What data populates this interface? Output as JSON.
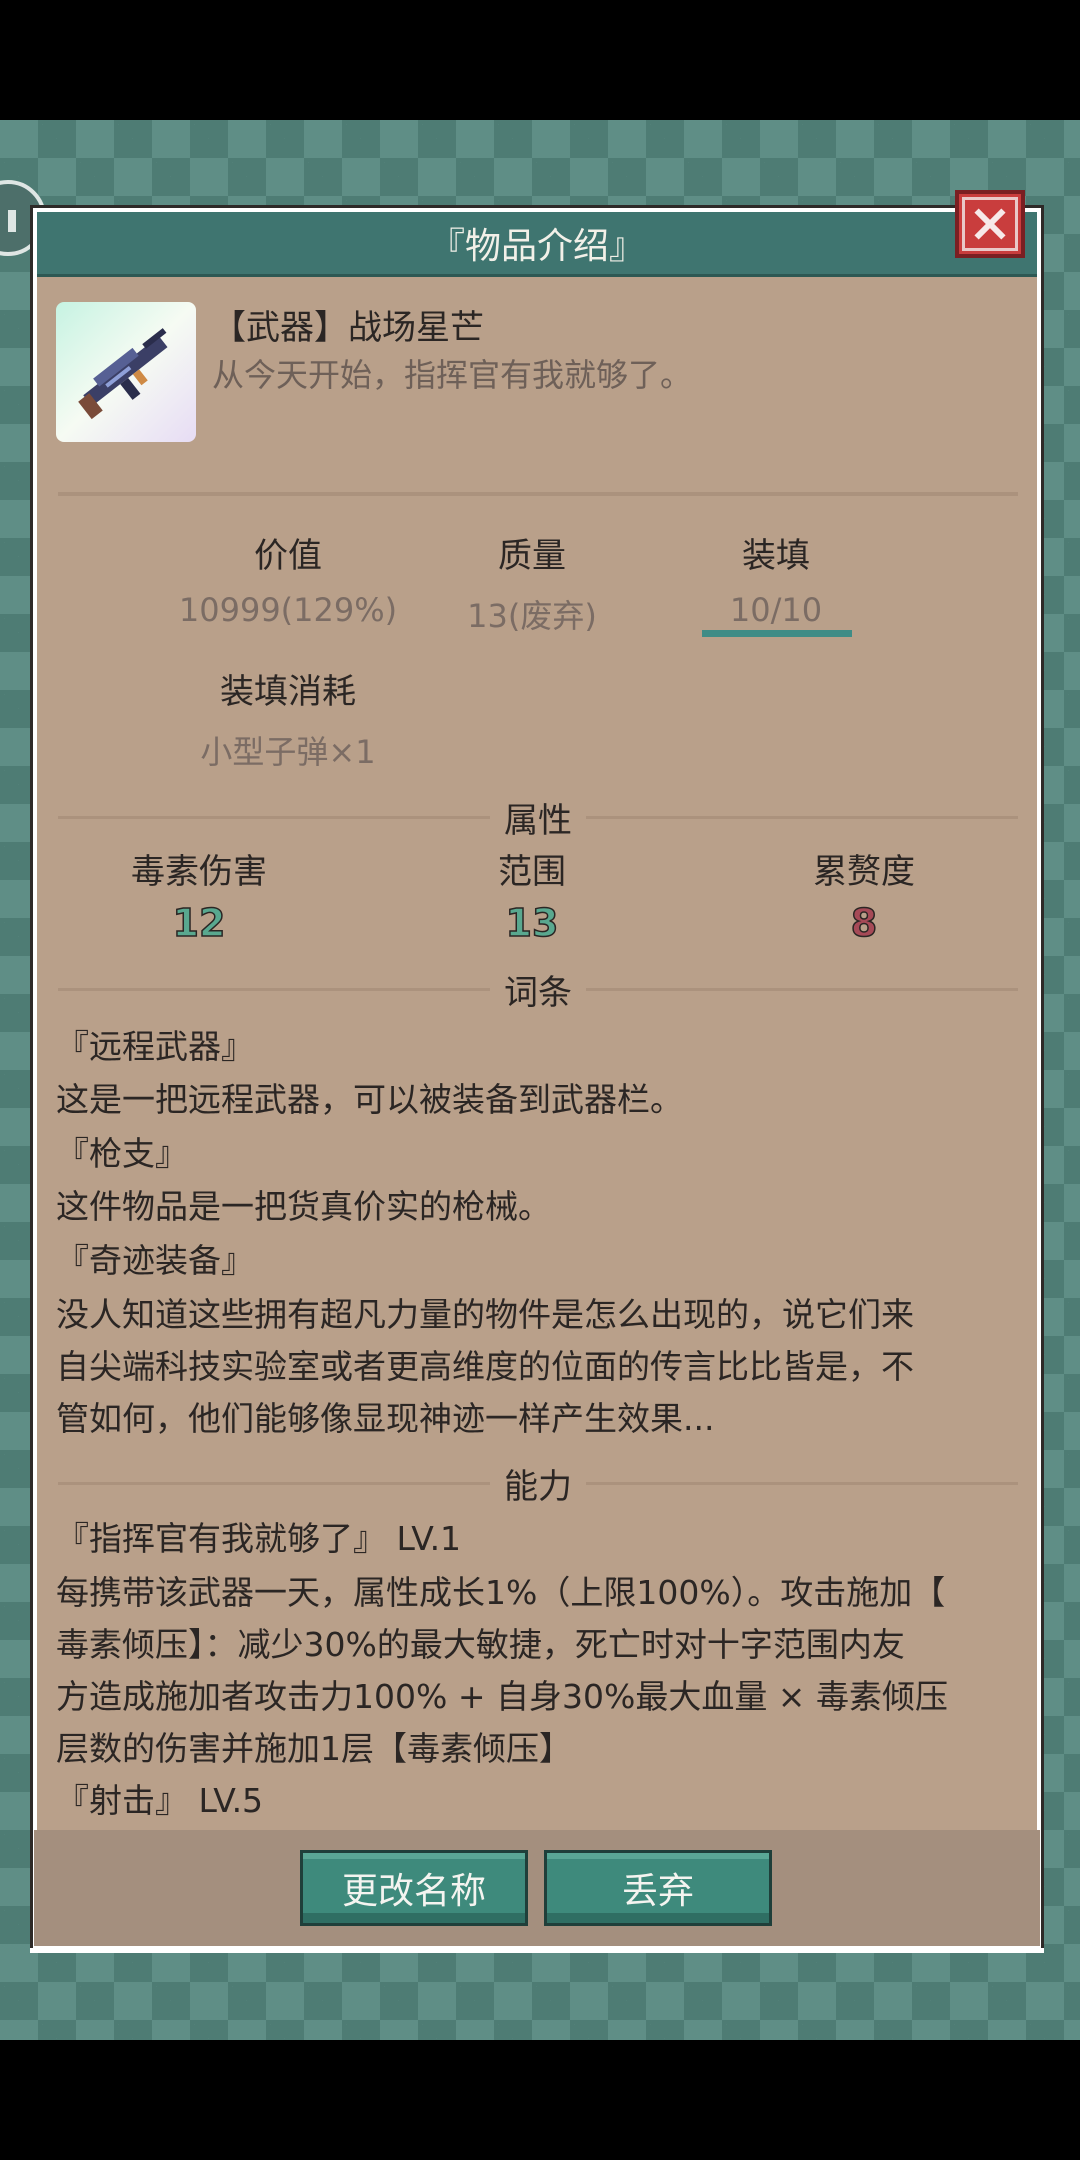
{
  "dialog": {
    "title": "『物品介绍』"
  },
  "item": {
    "name": "【武器】战场星芒",
    "quote": "从今天开始，指挥官有我就够了。",
    "icon": "rifle-icon"
  },
  "stats": {
    "value_label": "价值",
    "value_value": "10999(129%)",
    "quality_label": "质量",
    "quality_value": "13(废弃)",
    "ammo_label": "装填",
    "ammo_value": "10/10",
    "ammo_fill": 1.0,
    "ammo_cost_label": "装填消耗",
    "ammo_cost_value": "小型子弹×1"
  },
  "attributes": {
    "heading": "属性",
    "items": [
      {
        "label": "毒素伤害",
        "value": "12",
        "color": "#59a88f"
      },
      {
        "label": "范围",
        "value": "13",
        "color": "#59a88f"
      },
      {
        "label": "累赘度",
        "value": "8",
        "color": "#a64a57"
      }
    ]
  },
  "traits": {
    "heading": "词条",
    "lines": [
      "『远程武器』",
      "这是一把远程武器，可以被装备到武器栏。",
      "『枪支』",
      "这件物品是一把货真价实的枪械。",
      "『奇迹装备』",
      "没人知道这些拥有超凡力量的物件是怎么出现的，说它们来",
      "自尖端科技实验室或者更高维度的位面的传言比比皆是，不",
      "管如何，他们能够像显现神迹一样产生效果..."
    ]
  },
  "abilities": {
    "heading": "能力",
    "lines": [
      "『指挥官有我就够了』 LV.1",
      "每携带该武器一天，属性成长1%（上限100%）。攻击施加【",
      "毒素倾压】：减少30%的最大敏捷，死亡时对十字范围内友",
      "方造成施加者攻击力100% + 自身30%最大血量 × 毒素倾压",
      "层数的伤害并施加1层【毒素倾压】",
      "『射击』 LV.5"
    ]
  },
  "buttons": {
    "rename": "更改名称",
    "discard": "丢弃"
  }
}
